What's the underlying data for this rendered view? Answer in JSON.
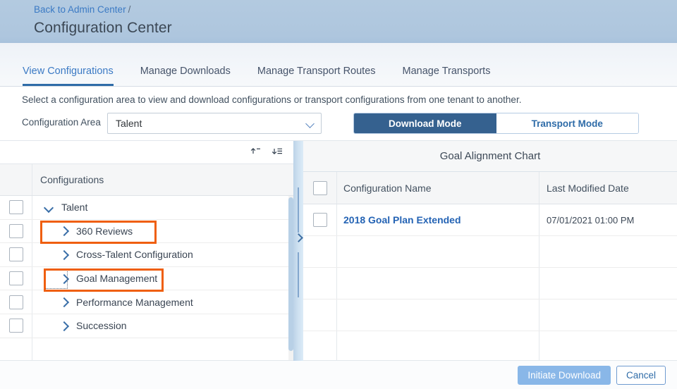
{
  "header": {
    "breadcrumb_link": "Back to Admin Center",
    "breadcrumb_separator": "/",
    "title": "Configuration Center"
  },
  "tabs": [
    {
      "label": "View Configurations",
      "active": true
    },
    {
      "label": "Manage Downloads",
      "active": false
    },
    {
      "label": "Manage Transport Routes",
      "active": false
    },
    {
      "label": "Manage Transports",
      "active": false
    }
  ],
  "instruction": "Select a configuration area to view and download configurations or transport configurations from one tenant to another.",
  "config_area": {
    "label": "Configuration Area",
    "selected": "Talent",
    "chevron_icon": "chevron-down-icon"
  },
  "mode_toggle": {
    "download_label": "Download Mode",
    "transport_label": "Transport Mode",
    "active": "Download Mode",
    "active_bg": "#35618f",
    "inactive_color": "#2f6ca8"
  },
  "left_panel": {
    "toolbar": {
      "collapse_all_icon": "collapse-all-icon",
      "expand_all_icon": "expand-all-icon"
    },
    "column_header": "Configurations",
    "tree": [
      {
        "label": "Talent",
        "level": 0,
        "expanded": true,
        "checked": false,
        "highlighted": false,
        "focused": false
      },
      {
        "label": "360 Reviews",
        "level": 1,
        "expanded": false,
        "checked": false,
        "highlighted": true,
        "focused": false
      },
      {
        "label": "Cross-Talent Configuration",
        "level": 1,
        "expanded": false,
        "checked": false,
        "highlighted": false,
        "focused": false
      },
      {
        "label": "Goal Management",
        "level": 1,
        "expanded": false,
        "checked": false,
        "highlighted": true,
        "focused": true
      },
      {
        "label": "Performance Management",
        "level": 1,
        "expanded": false,
        "checked": false,
        "highlighted": false,
        "focused": false
      },
      {
        "label": "Succession",
        "level": 1,
        "expanded": false,
        "checked": false,
        "highlighted": false,
        "focused": false
      }
    ]
  },
  "splitter": {
    "handle_icon": "chevron-right-icon"
  },
  "right_panel": {
    "title": "Goal Alignment Chart",
    "columns": [
      "Configuration Name",
      "Last Modified Date"
    ],
    "rows": [
      {
        "name": "2018 Goal Plan Extended",
        "date": "07/01/2021 01:00 PM",
        "checked": false
      }
    ]
  },
  "footer": {
    "primary_label": "Initiate Download",
    "primary_disabled": true,
    "secondary_label": "Cancel"
  },
  "colors": {
    "header_band": "#aec6de",
    "link": "#3b7ac4",
    "accent_blue": "#2f6ca8",
    "highlight_orange": "#ef5f10",
    "table_link": "#2463b4"
  }
}
